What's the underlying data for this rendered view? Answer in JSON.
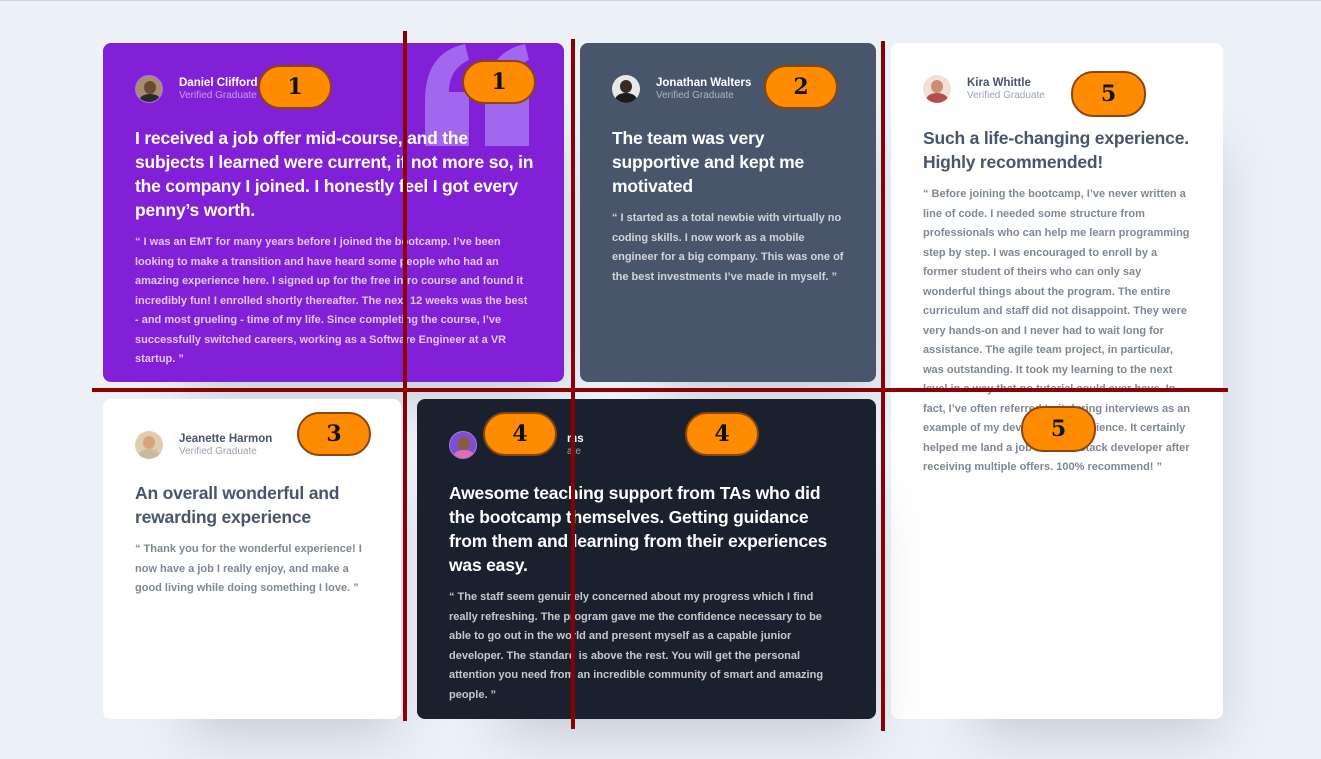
{
  "testimonials": [
    {
      "name": "Daniel Clifford",
      "role": "Verified Graduate",
      "title": "I received a job offer mid-course, and the subjects I learned were current, if not more so, in the company I joined. I honestly feel I got every penny’s worth.",
      "quote": "“ I was an EMT for many years before I joined the bootcamp. I’ve been looking to make a transition and have heard some people who had an amazing experience here. I signed up for the free intro course and found it incredibly fun! I enrolled shortly thereafter. The next 12 weeks was the best - and most grueling - time of my life. Since completing the course, I’ve successfully switched careers, working as a Software Engineer at a VR startup. ”",
      "color": "#8120d6"
    },
    {
      "name": "Jonathan Walters",
      "role": "Verified Graduate",
      "title": "The team was very supportive and kept me motivated",
      "quote": "“ I started as a total newbie with virtually no coding skills. I now work as a mobile engineer for a big company. This was one of the best investments I’ve made in myself. ”",
      "color": "#48556a"
    },
    {
      "name": "Jeanette Harmon",
      "role": "Verified Graduate",
      "title": "An overall wonderful and rewarding experience",
      "quote": "“ Thank you for the wonderful experience! I now have a job I really enjoy, and make a good living while doing something I love. ”",
      "color": "#ffffff"
    },
    {
      "name": "Patrick Abrams",
      "name_visible": "ms",
      "role": "Verified Graduate",
      "role_visible": "ate",
      "title": "Awesome teaching support from TAs who did the bootcamp themselves. Getting guidance from them and learning from their experiences was easy.",
      "quote": "“ The staff seem genuinely concerned about my progress which I find really refreshing. The program gave me the confidence necessary to be able to go out in the world and present myself as a capable junior developer. The standard is above the rest. You will get the personal attention you need from an incredible community of smart and amazing people. ”",
      "color": "#19212e"
    },
    {
      "name": "Kira Whittle",
      "role": "Verified Graduate",
      "title": "Such a life-changing experience. Highly recommended!",
      "quote": "“ Before joining the bootcamp, I’ve never written a line of code. I needed some structure from professionals who can help me learn programming step by step. I was encouraged to enroll by a former student of theirs who can only say wonderful things about the program. The entire curriculum and staff did not disappoint. They were very hands-on and I never had to wait long for assistance. The agile team project, in particular, was outstanding. It took my learning to the next level in a way that no tutorial could ever have. In fact, I’ve often referred to it during interviews as an example of my develoment experience. It certainly helped me land a job as a full-stack developer after receiving multiple offers. 100% recommend! ”",
      "color": "#ffffff"
    }
  ],
  "annotations": {
    "markers": [
      "1",
      "1",
      "2",
      "5",
      "3",
      "4",
      "4",
      "5"
    ]
  },
  "colors": {
    "background": "#ecf1f8",
    "accent_marker": "#ff8c00",
    "annotation_line": "#8b0000"
  }
}
